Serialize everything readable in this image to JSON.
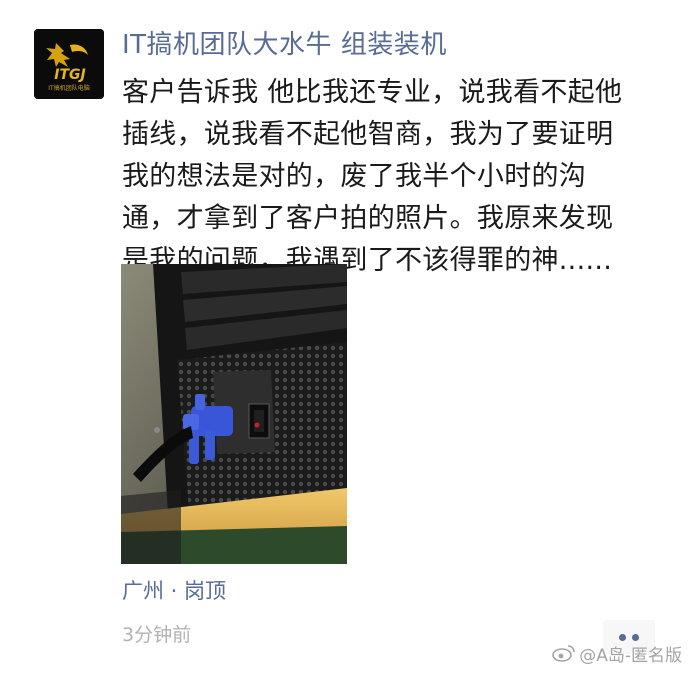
{
  "moment": {
    "avatar_text": "ITGJ",
    "avatar_subtext": "IT搞机团队电脑",
    "nickname": "IT搞机团队大水牛  组装装机",
    "text_lines": [
      "客户告诉我 他比我还专业，说我看不起他",
      "插线，说我看不起他智商，我为了要证明",
      "我的想法是对的，废了我半个小时的沟",
      "通，才拿到了客户拍的照片。我原来发现",
      "是我的问题，我遇到了不该得罪的神......"
    ],
    "location": "广州 · 岗顶",
    "time": "3分钟前",
    "action_icon": "more-dots-icon"
  },
  "watermark": {
    "text": "@A岛-匿名版",
    "icon": "weibo-icon"
  },
  "colors": {
    "link_blue": "#576b95",
    "text": "#1a1a1a",
    "time_gray": "#b2b2b2",
    "action_bg": "#f7f7f7"
  }
}
